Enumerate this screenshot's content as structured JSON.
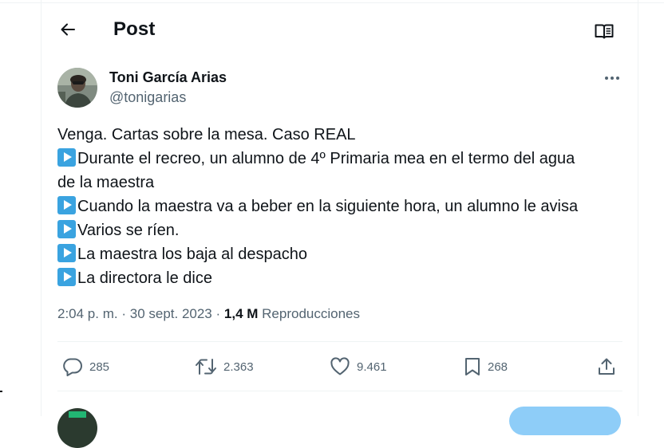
{
  "header": {
    "title": "Post",
    "back_icon": "arrow-left-icon",
    "reader_icon": "open-book-icon"
  },
  "tweet": {
    "author": {
      "name": "Toni García Arias",
      "handle": "@tonigarias"
    },
    "lines": [
      "Venga. Cartas sobre la mesa. Caso REAL",
      "Durante el recreo, un alumno de 4º Primaria mea en el termo del agua",
      "de la maestra",
      "Cuando la maestra va a beber en la siguiente hora, un alumno le avisa",
      "Varios se ríen.",
      "La maestra los baja al despacho",
      "La directora le dice"
    ],
    "time": "2:04 p. m.",
    "date": "30 sept. 2023",
    "views_count": "1,4 M",
    "views_label": "Reproducciones"
  },
  "actions": {
    "replies": "285",
    "reposts": "2.363",
    "likes": "9.461",
    "bookmarks": "268"
  },
  "colors": {
    "text": "#0f1419",
    "secondary": "#536471",
    "border": "#eff3f4",
    "emoji_blue": "#3aa3e0",
    "reply_button": "#8ecdf8"
  }
}
